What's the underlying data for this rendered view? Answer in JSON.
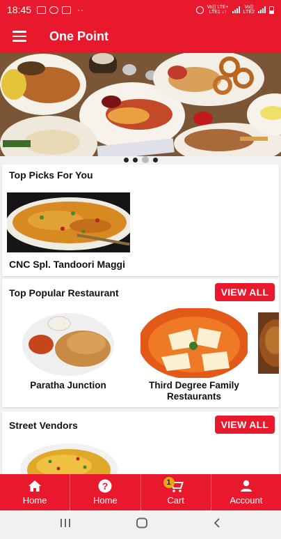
{
  "status_bar": {
    "time": "18:45",
    "left_icons": [
      "volte-icon",
      "whatsapp-icon",
      "message-icon",
      "dots-icon"
    ],
    "carrier1": "Vo)) LTE+",
    "carrier1_sub": "LTE1 ↓↑",
    "carrier2": "Vo))",
    "carrier2_sub": "LTE2"
  },
  "app_bar": {
    "title": "One Point",
    "menu_icon": "hamburger-icon"
  },
  "banner": {
    "dots_count": 4,
    "active_dot": 2
  },
  "top_picks": {
    "title": "Top Picks For You",
    "items": [
      {
        "name": "CNC Spl. Tandoori Maggi"
      }
    ]
  },
  "popular": {
    "title": "Top Popular Restaurant",
    "view_all": "VIEW ALL",
    "items": [
      {
        "name": "Paratha Junction"
      },
      {
        "name": "Third Degree Family Restaurants"
      }
    ]
  },
  "street_vendors": {
    "title": "Street Vendors",
    "view_all": "VIEW ALL"
  },
  "bottom_nav": {
    "items": [
      {
        "label": "Home",
        "icon": "home-icon"
      },
      {
        "label": "Home",
        "icon": "help-icon"
      },
      {
        "label": "Cart",
        "icon": "cart-icon",
        "badge": "1"
      },
      {
        "label": "Account",
        "icon": "account-icon"
      }
    ]
  },
  "colors": {
    "primary": "#e8192c",
    "badge": "#f2a516"
  }
}
